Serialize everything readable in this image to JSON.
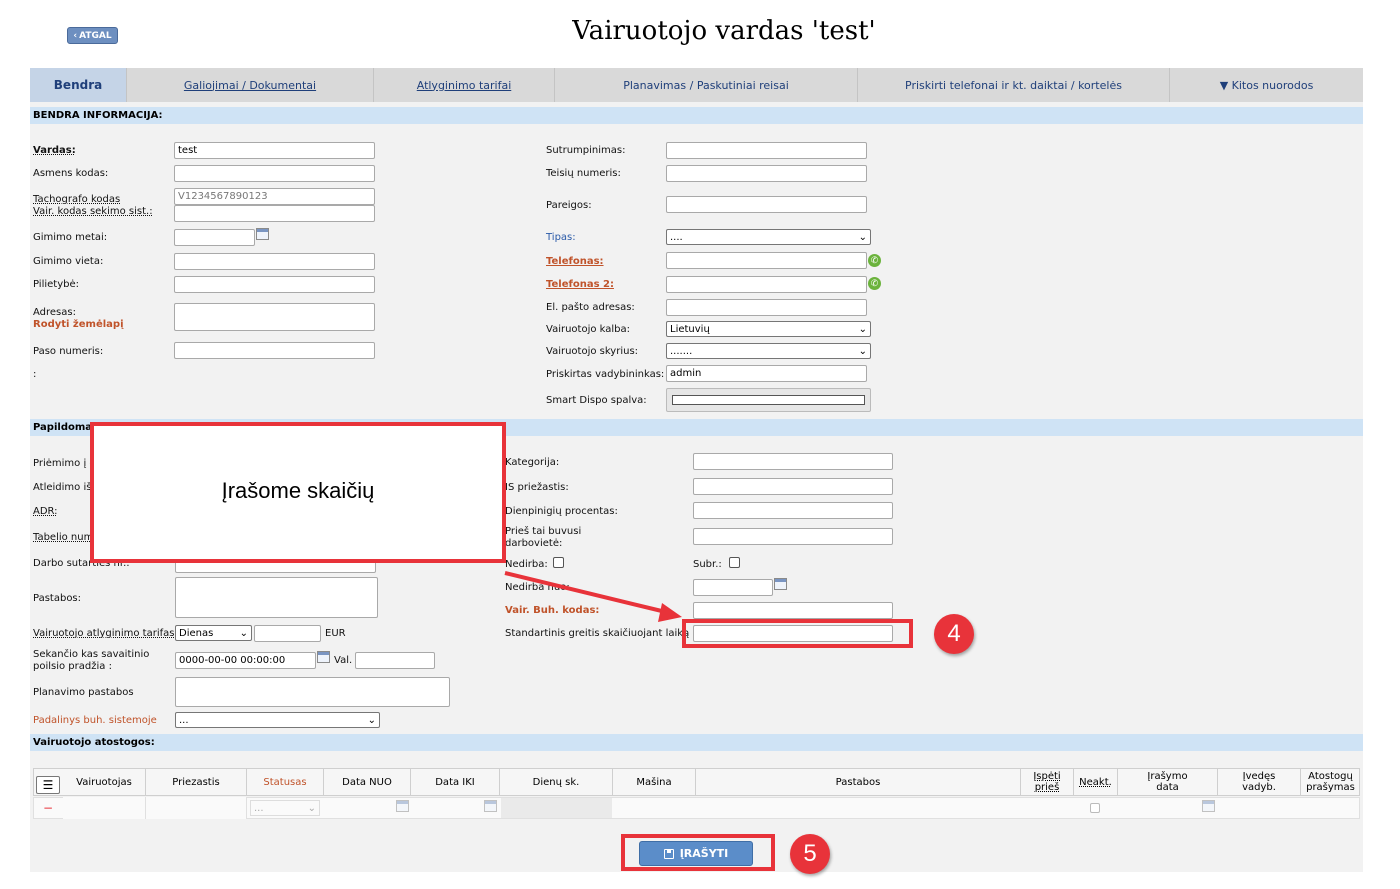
{
  "header": {
    "back_label": "ATGAL",
    "title": "Vairuotojo vardas 'test'"
  },
  "tabs": [
    {
      "label": "Bendra"
    },
    {
      "label": "Galiojimai / Dokumentai"
    },
    {
      "label": "Atlyginimo tarifai"
    },
    {
      "label": "Planavimas / Paskutiniai reisai"
    },
    {
      "label": "Priskirti telefonai ir kt. daiktai / kortelės"
    },
    {
      "label": "▼ Kitos nuorodos"
    }
  ],
  "sections": {
    "general": "BENDRA INFORMACIJA:",
    "additional": "Papildoma",
    "vacations": "Vairuotojo atostogos:"
  },
  "general_left": {
    "vardas_label": "Vardas:",
    "vardas_value": "test",
    "asmens_kodas_label": "Asmens kodas:",
    "tachografo_label": "Tachografo kodas",
    "tachografo_value": "V1234567890123",
    "vair_kodas_label": "Vair. kodas sekimo sist.:",
    "gimimo_metai_label": "Gimimo metai:",
    "gimimo_vieta_label": "Gimimo vieta:",
    "pilietybe_label": "Pilietybė:",
    "adresas_label": "Adresas:",
    "rodyti_zemelapi": "Rodyti žemėlapį",
    "paso_label": "Paso numeris:",
    "colon_label": ":"
  },
  "general_right": {
    "sutrumpinimas_label": "Sutrumpinimas:",
    "teisiu_label": "Teisių numeris:",
    "pareigos_label": "Pareigos:",
    "tipas_label": "Tipas:",
    "tipas_value": "....",
    "telefonas_label": "Telefonas:",
    "telefonas2_label": "Telefonas 2:",
    "el_pastas_label": "El. pašto adresas:",
    "kalba_label": "Vairuotojo kalba:",
    "kalba_value": "Lietuvių",
    "skyrius_label": "Vairuotojo skyrius:",
    "skyrius_value": ".......",
    "vadybininkas_label": "Priskirtas vadybininkas:",
    "vadybininkas_value": "admin",
    "spalva_label": "Smart Dispo spalva:"
  },
  "additional_left": {
    "priemimo_label": "Priėmimo į d",
    "atleidimo_label": "Atleidimo iš",
    "adr_label": "ADR:",
    "tabelio_label": "Tabelio num",
    "darbo_label": "Darbo sutarties nr.:",
    "pastabos_label": "Pastabos:",
    "tarifas_label": "Vairuotojo atlyginimo tarifas",
    "tarifas_select": "Dienas",
    "currency": "EUR",
    "sekancio_label_1": "Sekančio kas savaitinio",
    "sekancio_label_2": "poilsio pradžia :",
    "sekancio_value": "0000-00-00 00:00:00",
    "val_label": "Val.",
    "planavimo_label": "Planavimo pastabos",
    "padalinys_label": "Padalinys buh. sistemoje",
    "padalinys_value": "..."
  },
  "additional_right": {
    "kategorija_label": "Kategorija:",
    "priezastis_label": "IS priežastis:",
    "dienpinigiu_label": "Dienpinigių procentas:",
    "pries_tai_1": "Prieš tai buvusi",
    "pries_tai_2": "darbovietė:",
    "nedirba_chk_label": "Nedirba:",
    "subr_label": "Subr.:",
    "nedirba_nuo_label": "Nedirba nuo:",
    "buh_kodas_label": "Vair. Buh. kodas:",
    "greitis_label": "Standartinis greitis skaičiuojant laiką"
  },
  "vacation_table": {
    "columns": [
      "Vairuotojas",
      "Priezastis",
      "Statusas",
      "Data NUO",
      "Data IKI",
      "Dienų sk.",
      "Mašina",
      "Pastabos",
      "Įspėti prieš",
      "Neakt.",
      "Įrašymo data",
      "Įvedęs vadyb.",
      "Atostogų prašymas"
    ],
    "row_status_value": "..."
  },
  "callout": {
    "text": "Įrašome skaičių",
    "badge4": "4",
    "badge5": "5"
  },
  "footer": {
    "save_label": "ĮRAŠYTI"
  },
  "colors": {
    "accent": "#5b8dc9",
    "annotation": "#e8333a",
    "section_band": "#cfe3f5"
  }
}
